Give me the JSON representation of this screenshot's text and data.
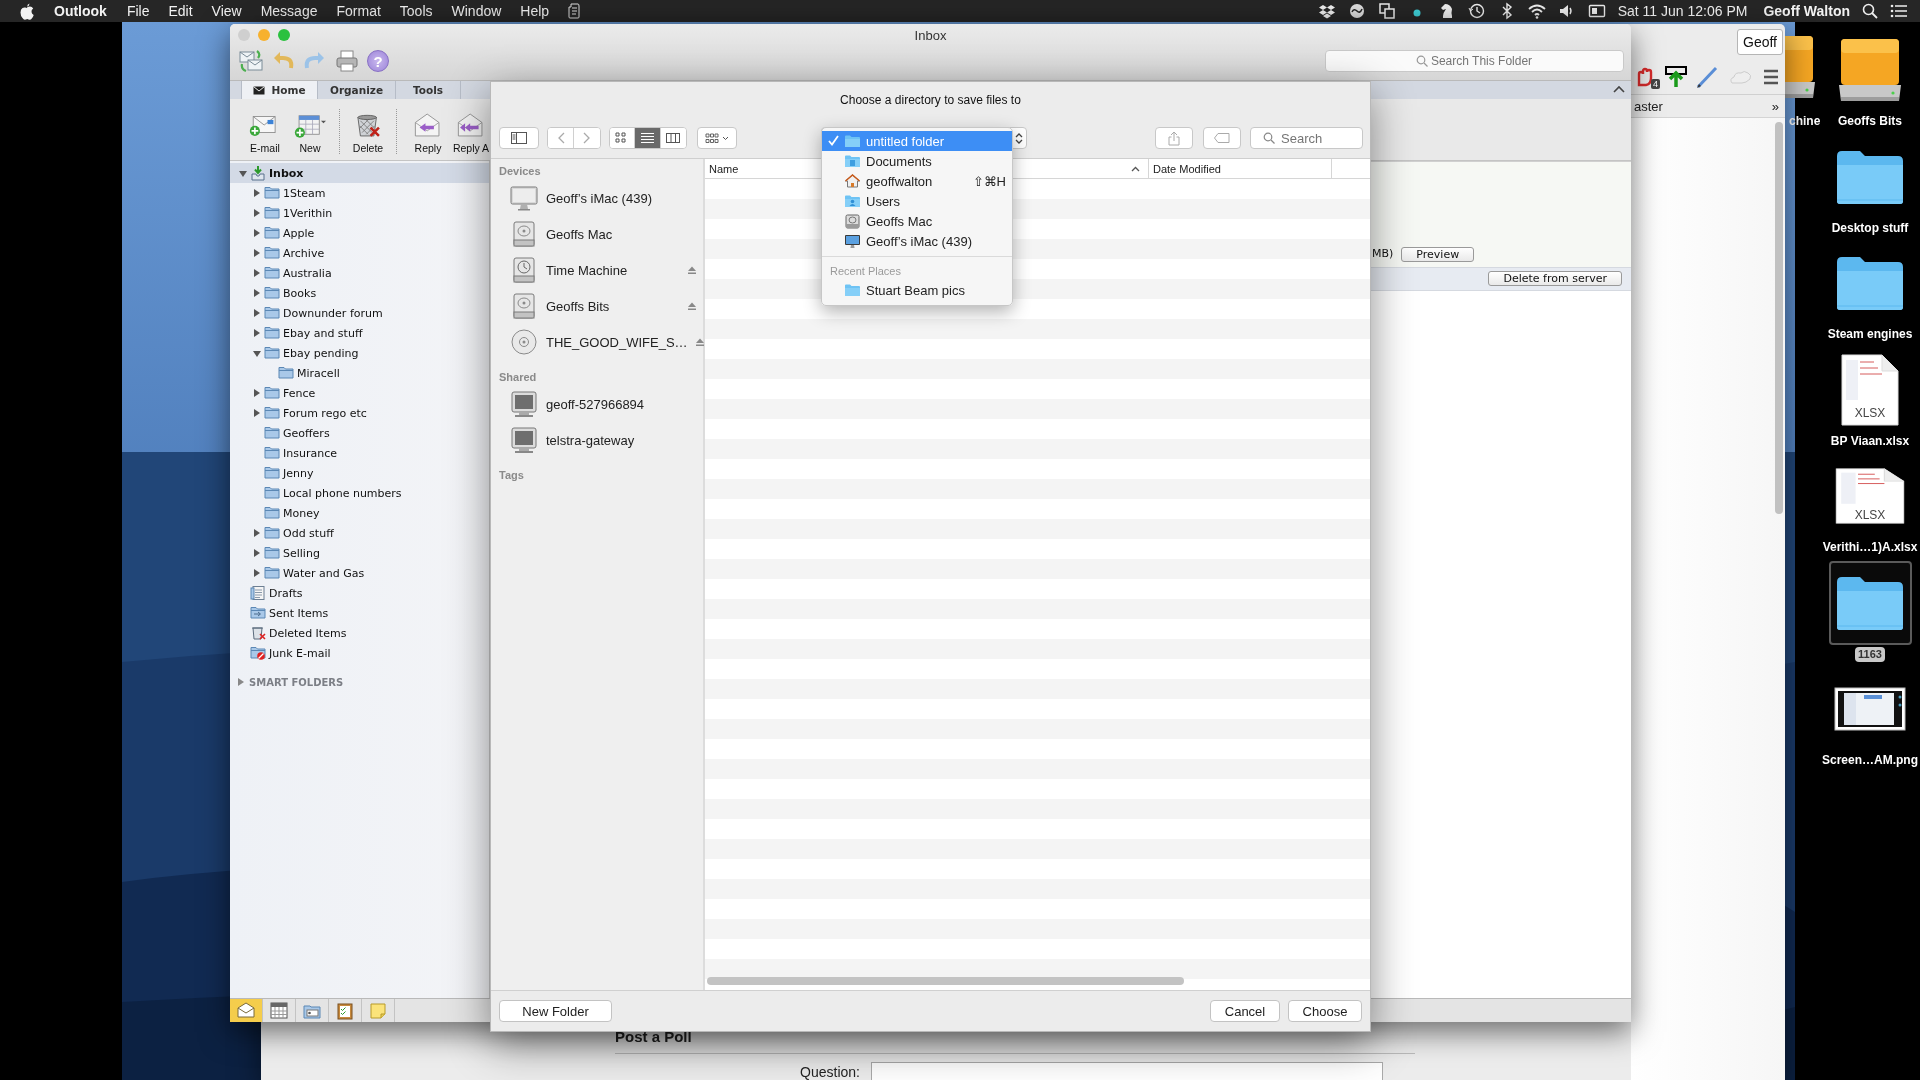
{
  "menu_bar": {
    "app": "Outlook",
    "menus": [
      "File",
      "Edit",
      "View",
      "Message",
      "Format",
      "Tools",
      "Window",
      "Help"
    ],
    "clock": "Sat 11 Jun 12:06 PM",
    "user": "Geoff Walton"
  },
  "browser": {
    "profile": "Geoff",
    "extension_badge": "4",
    "bookmark": "aster",
    "more": "»",
    "poll_title": "Post a Poll",
    "question_label": "Question:"
  },
  "outlook": {
    "title": "Inbox",
    "help": "?",
    "search": {
      "placeholder": "Search This Folder"
    },
    "tabs": [
      {
        "label": "Home",
        "selected": true
      },
      {
        "label": "Organize",
        "selected": false
      },
      {
        "label": "Tools",
        "selected": false
      }
    ],
    "ribbon": [
      {
        "kind": "email",
        "label": "E-mail"
      },
      {
        "kind": "new",
        "label": "New"
      },
      {
        "kind": "delete",
        "label": "Delete"
      },
      {
        "kind": "reply",
        "label": "Reply"
      },
      {
        "kind": "reply_all",
        "label": "Reply A"
      }
    ],
    "folders": [
      {
        "kind": "inbox",
        "label": "Inbox",
        "expanded": true,
        "selected": true,
        "children": [
          {
            "kind": "folder",
            "label": "1Steam",
            "expanded": false,
            "selected": false
          },
          {
            "kind": "folder",
            "label": "1Verithin",
            "expanded": false,
            "selected": false
          },
          {
            "kind": "folder",
            "label": "Apple",
            "expanded": false,
            "selected": false
          },
          {
            "kind": "folder",
            "label": "Archive",
            "expanded": false,
            "selected": false
          },
          {
            "kind": "folder",
            "label": "Australia",
            "expanded": false,
            "selected": false
          },
          {
            "kind": "folder",
            "label": "Books",
            "expanded": false,
            "selected": false
          },
          {
            "kind": "folder",
            "label": "Downunder forum",
            "expanded": false,
            "selected": false
          },
          {
            "kind": "folder",
            "label": "Ebay and stuff",
            "expanded": false,
            "selected": false
          },
          {
            "kind": "folder",
            "label": "Ebay pending",
            "expanded": true,
            "selected": false,
            "children": [
              {
                "kind": "folder",
                "label": "Miracell",
                "selected": false
              }
            ]
          },
          {
            "kind": "folder",
            "label": "Fence",
            "expanded": false,
            "selected": false
          },
          {
            "kind": "folder",
            "label": "Forum rego etc",
            "expanded": false,
            "selected": false
          },
          {
            "kind": "folder",
            "label": "Geoffers",
            "selected": false
          },
          {
            "kind": "folder",
            "label": "Insurance",
            "selected": false
          },
          {
            "kind": "folder",
            "label": "Jenny",
            "selected": false
          },
          {
            "kind": "folder",
            "label": "Local phone numbers",
            "selected": false
          },
          {
            "kind": "folder",
            "label": "Money",
            "selected": false
          },
          {
            "kind": "folder",
            "label": "Odd stuff",
            "expanded": false,
            "selected": false
          },
          {
            "kind": "folder",
            "label": "Selling",
            "expanded": false,
            "selected": false
          },
          {
            "kind": "folder",
            "label": "Water and Gas",
            "expanded": false,
            "selected": false
          }
        ]
      },
      {
        "kind": "drafts",
        "label": "Drafts",
        "selected": false
      },
      {
        "kind": "sent",
        "label": "Sent Items",
        "selected": false
      },
      {
        "kind": "deleted",
        "label": "Deleted Items",
        "selected": false
      },
      {
        "kind": "junk",
        "label": "Junk E-mail",
        "selected": false
      }
    ],
    "smart_folders": {
      "label": "SMART FOLDERS",
      "expanded": false
    },
    "message": {
      "size": "MB)",
      "actions": [
        "Preview",
        "Delete from server"
      ]
    },
    "nav": [
      {
        "kind": "mail",
        "selected": true
      },
      {
        "kind": "calendar",
        "selected": false
      },
      {
        "kind": "contacts",
        "selected": false
      },
      {
        "kind": "tasks",
        "selected": false
      },
      {
        "kind": "notes",
        "selected": false
      }
    ]
  },
  "dialog": {
    "title": "Choose a directory to save files to",
    "view_modes": [
      {
        "kind": "icons",
        "selected": false
      },
      {
        "kind": "list",
        "selected": true
      },
      {
        "kind": "columns",
        "selected": false
      }
    ],
    "search": {
      "placeholder": "Search"
    },
    "sidebar": [
      {
        "heading": "Devices",
        "items": [
          {
            "kind": "imac",
            "label": "Geoff’s iMac (439)",
            "eject": false
          },
          {
            "kind": "disk",
            "label": "Geoffs Mac",
            "eject": false
          },
          {
            "kind": "time_machine",
            "label": "Time Machine",
            "eject": true
          },
          {
            "kind": "disk",
            "label": "Geoffs Bits",
            "eject": true
          },
          {
            "kind": "disc",
            "label": "THE_GOOD_WIFE_S…",
            "eject": true
          }
        ]
      },
      {
        "heading": "Shared",
        "items": [
          {
            "kind": "network",
            "label": "geoff-527966894",
            "eject": false
          },
          {
            "kind": "network",
            "label": "telstra-gateway",
            "eject": false
          }
        ]
      },
      {
        "heading": "Tags"
      }
    ],
    "columns": [
      {
        "label": "Name",
        "sorted": true
      },
      {
        "label": "Date Modified",
        "sorted": false
      }
    ],
    "location_menu": {
      "items": [
        {
          "kind": "folder",
          "label": "untitled folder",
          "selected": true
        },
        {
          "kind": "documents",
          "label": "Documents",
          "selected": false
        },
        {
          "kind": "home",
          "label": "geoffwalton",
          "shortcut": "⇧⌘H",
          "selected": false
        },
        {
          "kind": "users",
          "label": "Users",
          "selected": false
        },
        {
          "kind": "disk",
          "label": "Geoffs Mac",
          "selected": false
        },
        {
          "kind": "imac",
          "label": "Geoff’s iMac (439)",
          "selected": false
        }
      ],
      "recent_heading": "Recent Places",
      "recent": [
        {
          "kind": "folder",
          "label": "Stuart Beam pics",
          "selected": false
        }
      ]
    },
    "buttons": {
      "new_folder": "New Folder",
      "cancel": "Cancel",
      "default": "Choose"
    }
  },
  "desktop": {
    "partial_icon": {
      "kind": "drive",
      "label": "chine"
    },
    "icons": [
      {
        "kind": "drive",
        "label": "Geoffs Bits",
        "selected": false
      },
      {
        "kind": "folder",
        "label": "Desktop stuff",
        "selected": false
      },
      {
        "kind": "folder",
        "label": "Steam engines",
        "selected": false
      },
      {
        "kind": "spreadsheet",
        "label": "BP Viaan.xlsx",
        "badge": "XLSX",
        "selected": false
      },
      {
        "kind": "spreadsheet",
        "label": "Verithi…1)A.xlsx",
        "badge": "XLSX",
        "selected": false
      },
      {
        "kind": "folder",
        "label": "1163",
        "selected": true
      },
      {
        "kind": "screenshot",
        "label": "Screen…AM.png",
        "selected": false
      }
    ]
  }
}
